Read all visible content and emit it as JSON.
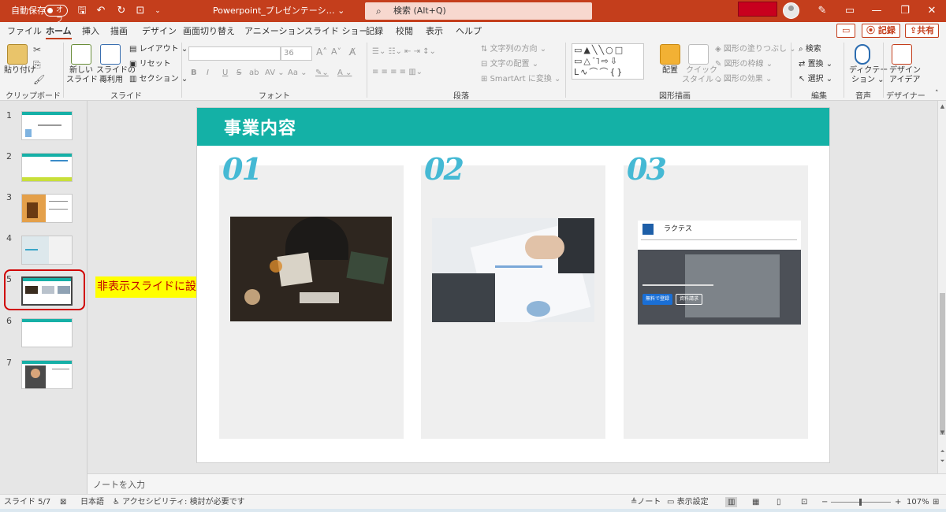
{
  "titlebar": {
    "autosave_label": "自動保存",
    "autosave_state": "オフ",
    "doc_title": "Powerpoint_プレゼンテーシ… ⌄",
    "search_placeholder": "検索 (Alt+Q)"
  },
  "menu": {
    "tabs": [
      "ファイル",
      "ホーム",
      "挿入",
      "描画",
      "デザイン",
      "画面切り替え",
      "アニメーション",
      "スライド ショー",
      "記録",
      "校閲",
      "表示",
      "ヘルプ"
    ],
    "active_tab": "ホーム",
    "record_button": "記録",
    "share_button": "共有"
  },
  "ribbon": {
    "clipboard": {
      "paste": "貼り付け",
      "group": "クリップボード"
    },
    "slides": {
      "new_slide_1": "新しい",
      "new_slide_2": "スライド ⌄",
      "reuse_1": "スライドの",
      "reuse_2": "再利用",
      "layout": "レイアウト ⌄",
      "reset": "リセット",
      "section": "セクション ⌄",
      "group": "スライド"
    },
    "font": {
      "size": "36",
      "group": "フォント",
      "buttons": [
        "B",
        "I",
        "U",
        "S",
        "ab",
        "AV ⌄",
        "Aa ⌄",
        "A ⌄"
      ]
    },
    "paragraph": {
      "text_direction": "文字列の方向 ⌄",
      "align_text": "文字の配置 ⌄",
      "smartart": "SmartArt に変換 ⌄",
      "group": "段落"
    },
    "drawing": {
      "arrange_1": "配置",
      "quick_style_1": "クイック",
      "quick_style_2": "スタイル ⌄",
      "fill": "図形の塗りつぶし ⌄",
      "outline": "図形の枠線 ⌄",
      "effects": "図形の効果 ⌄",
      "group": "図形描画"
    },
    "editing": {
      "find": "検索",
      "replace": "置換 ⌄",
      "select": "選択 ⌄",
      "group": "編集"
    },
    "voice": {
      "dictate_1": "ディクテー",
      "dictate_2": "ション ⌄",
      "group": "音声"
    },
    "designer": {
      "ideas_1": "デザイン",
      "ideas_2": "アイデア",
      "group": "デザイナー"
    }
  },
  "thumbnails": {
    "numbers": [
      "1",
      "2",
      "3",
      "4",
      "5",
      "6",
      "7"
    ],
    "callout": "非表示スライドに設定する"
  },
  "slide": {
    "title": "事業内容",
    "cards": [
      {
        "num": "01"
      },
      {
        "num": "02"
      },
      {
        "num": "03"
      }
    ],
    "card3_brand": "ラクテス",
    "card3_btn1": "無料で登録",
    "card3_btn2": "資料請求"
  },
  "notes": {
    "placeholder": "ノートを入力"
  },
  "status": {
    "slide_info": "スライド 5/7",
    "language": "日本語",
    "accessibility": "アクセシビリティ: 検討が必要です",
    "notes_btn": "ノート",
    "display_settings": "表示設定",
    "zoom": "107%"
  }
}
